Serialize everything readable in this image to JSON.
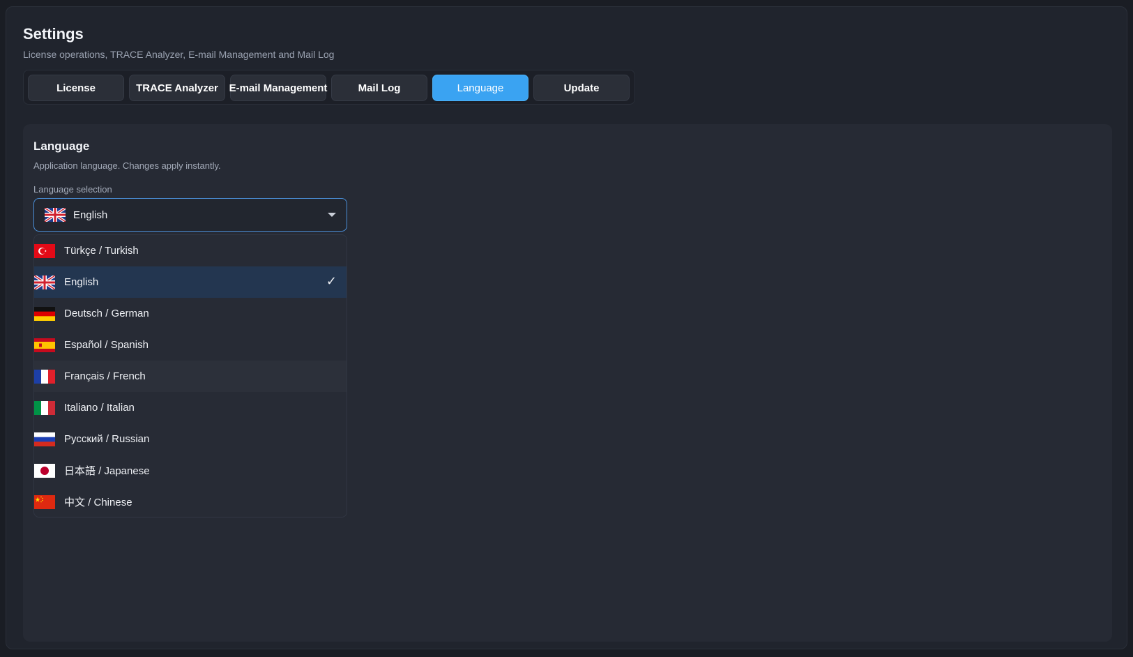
{
  "header": {
    "title": "Settings",
    "subtitle": "License operations, TRACE Analyzer, E-mail Management and Mail Log"
  },
  "tabs": [
    {
      "label": "License"
    },
    {
      "label": "TRACE Analyzer"
    },
    {
      "label": "E-mail Management"
    },
    {
      "label": "Mail Log"
    },
    {
      "label": "Language",
      "active": true
    },
    {
      "label": "Update"
    }
  ],
  "language_panel": {
    "title": "Language",
    "description": "Application language. Changes apply instantly.",
    "field_label": "Language selection",
    "selected_value": "English",
    "selected_icon": "uk-flag-icon",
    "options": [
      {
        "label": "Türkçe / Turkish",
        "icon": "turkey-flag-icon"
      },
      {
        "label": "English",
        "icon": "uk-flag-icon",
        "selected": true
      },
      {
        "label": "Deutsch / German",
        "icon": "germany-flag-icon"
      },
      {
        "label": "Español / Spanish",
        "icon": "spain-flag-icon"
      },
      {
        "label": "Français / French",
        "icon": "france-flag-icon"
      },
      {
        "label": "Italiano / Italian",
        "icon": "italy-flag-icon"
      },
      {
        "label": "Русский / Russian",
        "icon": "russia-flag-icon"
      },
      {
        "label": "日本語 / Japanese",
        "icon": "japan-flag-icon"
      },
      {
        "label": "中文 / Chinese",
        "icon": "china-flag-icon"
      }
    ],
    "check_icon": "✓"
  },
  "colors": {
    "accent": "#3aa3f2",
    "background": "#20242d",
    "panel": "#262a34",
    "selected_row": "#233650"
  }
}
